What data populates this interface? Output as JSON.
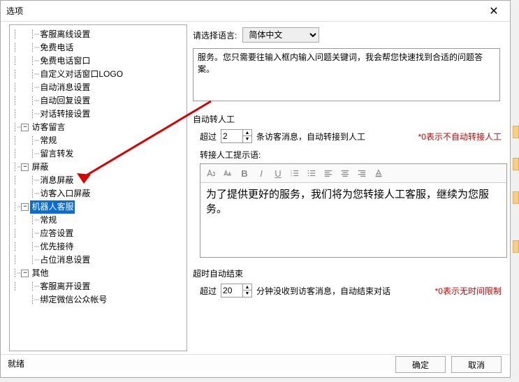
{
  "window": {
    "title": "选项",
    "status": "就绪"
  },
  "buttons": {
    "ok": "确定",
    "cancel": "取消"
  },
  "language": {
    "label": "请选择语言:",
    "selected": "简体中文"
  },
  "greeting_text": "服务。您只需要往输入框内输入问题关键词，我会帮您快速找到合适的问题答案。",
  "auto_transfer": {
    "title": "自动转人工",
    "prefix": "超过",
    "value": "2",
    "suffix": "条访客消息，自动转接到人工",
    "hint": "*0表示不自动转接人工",
    "prompt_label": "转接人工提示语:",
    "prompt_text": "为了提供更好的服务，我们将为您转接人工客服，继续为您服务。"
  },
  "timeout": {
    "title": "超时自动结束",
    "prefix": "超过",
    "value": "20",
    "suffix": "分钟没收到访客消息，自动结束对话",
    "hint": "*0表示无时间限制"
  },
  "tree": {
    "i0": "客服离线设置",
    "i1": "免费电话",
    "i2": "免费电话窗口",
    "i3": "自定义对话窗口LOGO",
    "i4": "自动消息设置",
    "i5": "自动回复设置",
    "i6": "对话转接设置",
    "g1": "访客留言",
    "i7": "常规",
    "i8": "留言转发",
    "g2": "屏蔽",
    "i9": "消息屏蔽",
    "i10": "访客入口屏蔽",
    "g3": "机器人客服",
    "i11": "常规",
    "i12": "应答设置",
    "i13": "优先接待",
    "i14": "占位消息设置",
    "g4": "其他",
    "i15": "客服离开设置",
    "i16": "绑定微信公众帐号"
  }
}
